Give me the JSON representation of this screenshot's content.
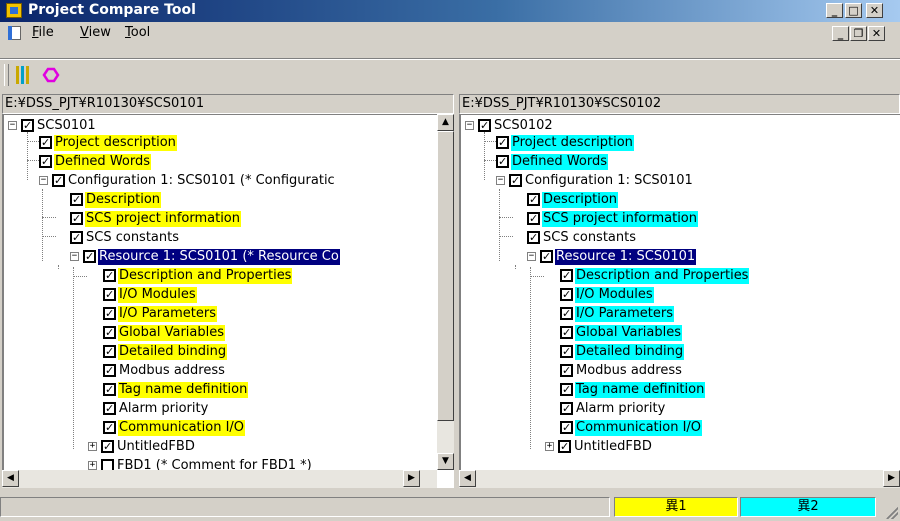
{
  "window": {
    "title": "Project Compare Tool"
  },
  "menu": {
    "items": [
      {
        "label": "File",
        "key": "F",
        "rest": "ile"
      },
      {
        "label": "View",
        "key": "V",
        "rest": "iew"
      },
      {
        "label": "Tool",
        "key": "T",
        "rest": "ool"
      }
    ]
  },
  "toolbar": {
    "buttons": [
      "compare-icon",
      "hexagon-icon"
    ]
  },
  "left_pane": {
    "path": "E:¥DSS_PJT¥R10130¥SCS0101",
    "items": [
      "SCS0101",
      "Project description",
      "Defined Words",
      "Configuration 1: SCS0101 (* Configuratic",
      "Description",
      "SCS project information",
      "SCS constants",
      "Resource 1: SCS0101 (* Resource Co",
      "Description and Properties",
      "I/O Modules",
      "I/O Parameters",
      "Global Variables",
      "Detailed binding",
      "Modbus address",
      "Tag name definition",
      "Alarm priority",
      "Communication I/O",
      "UntitledFBD",
      "FBD1 (* Comment for FBD1 *)"
    ],
    "highlight_color": "#ffff00"
  },
  "right_pane": {
    "path": "E:¥DSS_PJT¥R10130¥SCS0102",
    "items": [
      "SCS0102",
      "Project description",
      "Defined Words",
      "Configuration 1: SCS0101",
      "Description",
      "SCS project information",
      "SCS constants",
      "Resource 1: SCS0101",
      "Description and Properties",
      "I/O Modules",
      "I/O Parameters",
      "Global Variables",
      "Detailed binding",
      "Modbus address",
      "Tag name definition",
      "Alarm priority",
      "Communication I/O",
      "UntitledFBD"
    ],
    "highlight_color": "#00ffff"
  },
  "status": {
    "diff1": "異1",
    "diff2": "異2",
    "diff1_color": "#ffff00",
    "diff2_color": "#00ffff"
  }
}
